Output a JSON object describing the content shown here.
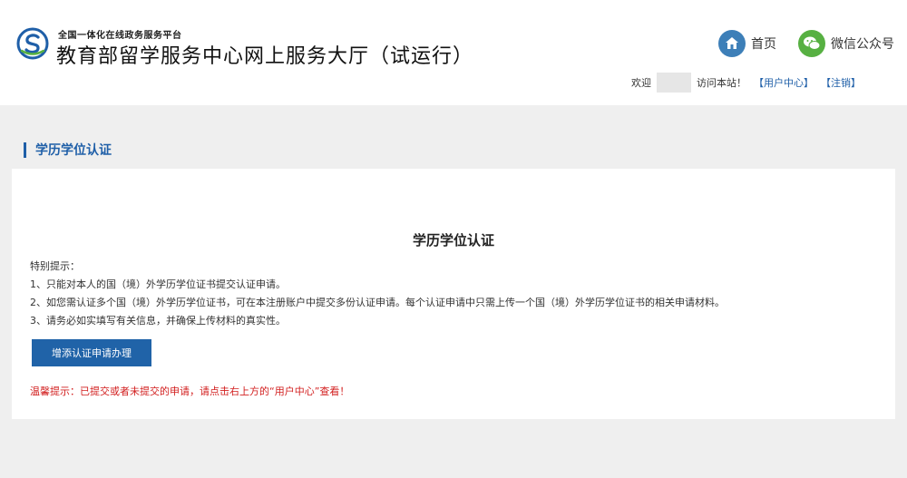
{
  "header": {
    "subtitle": "全国一体化在线政务服务平台",
    "title": "教育部留学服务中心网上服务大厅（试运行）",
    "nav": {
      "home_label": "首页",
      "home_icon": "home-icon",
      "wechat_label": "微信公众号",
      "wechat_icon": "wechat-icon"
    },
    "welcome": {
      "prefix": "欢迎",
      "suffix": "访问本站！",
      "user_center_link": "【用户中心】",
      "logout_link": "【注销】"
    }
  },
  "section": {
    "title": "学历学位认证"
  },
  "panel": {
    "title": "学历学位认证",
    "notice_heading": "特别提示：",
    "notices": [
      "1、只能对本人的国（境）外学历学位证书提交认证申请。",
      "2、如您需认证多个国（境）外学历学位证书，可在本注册账户中提交多份认证申请。每个认证申请中只需上传一个国（境）外学历学位证书的相关申请材料。",
      "3、请务必如实填写有关信息，并确保上传材料的真实性。"
    ],
    "add_button_label": "增添认证申请办理",
    "warning": "温馨提示：已提交或者未提交的申请，请点击右上方的“用户中心”查看！"
  },
  "colors": {
    "accent": "#1f5fa8",
    "button": "#2063a8",
    "warning": "#d21f1f",
    "home_icon_bg": "#3d7fb8",
    "wechat_icon_bg": "#57b042"
  }
}
